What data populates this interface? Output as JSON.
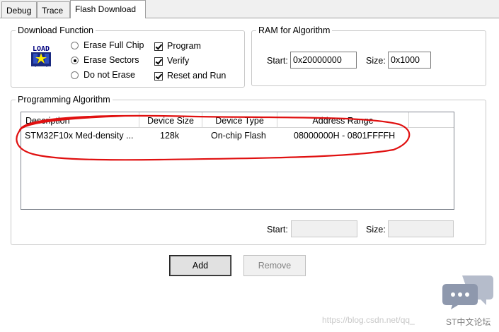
{
  "tabs": [
    {
      "label": "Debug",
      "active": false
    },
    {
      "label": "Trace",
      "active": false
    },
    {
      "label": "Flash Download",
      "active": true
    }
  ],
  "download_function": {
    "title": "Download Function",
    "icon": "load-icon",
    "icon_text": "LOAD",
    "erase_options": [
      {
        "label": "Erase Full Chip",
        "selected": false
      },
      {
        "label": "Erase Sectors",
        "selected": true
      },
      {
        "label": "Do not Erase",
        "selected": false
      }
    ],
    "checks": [
      {
        "label": "Program",
        "checked": true
      },
      {
        "label": "Verify",
        "checked": true
      },
      {
        "label": "Reset and Run",
        "checked": true
      }
    ]
  },
  "ram": {
    "title": "RAM for Algorithm",
    "start_label": "Start:",
    "start_value": "0x20000000",
    "size_label": "Size:",
    "size_value": "0x1000"
  },
  "programming": {
    "title": "Programming Algorithm",
    "columns": [
      "Description",
      "Device Size",
      "Device Type",
      "Address Range"
    ],
    "rows": [
      {
        "description": "STM32F10x Med-density ...",
        "size": "128k",
        "type": "On-chip Flash",
        "range": "08000000H - 0801FFFFH"
      }
    ],
    "start_label": "Start:",
    "start_value": "",
    "size_label": "Size:",
    "size_value": ""
  },
  "buttons": {
    "add": "Add",
    "remove": "Remove"
  },
  "annotation_color": "#e01010",
  "watermark": {
    "url": "https://blog.csdn.net/qq_",
    "brand": "ST中文论坛"
  }
}
